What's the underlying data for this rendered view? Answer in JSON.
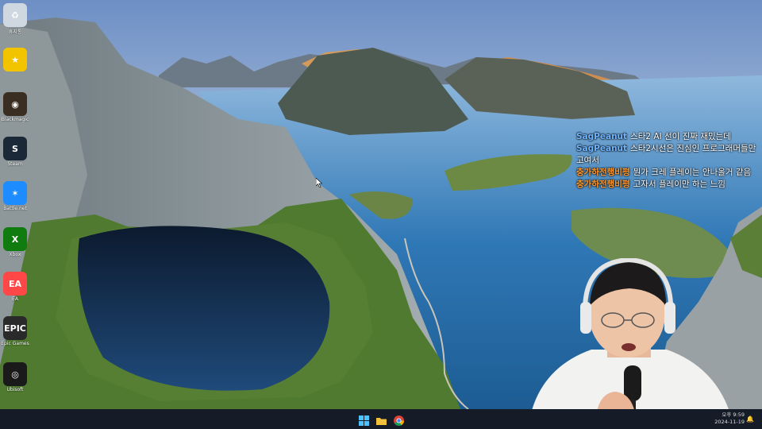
{
  "desktop_icons": [
    {
      "name": "recycle-bin",
      "label": "휴지통",
      "glyph": "♻",
      "color": "#cfd8e0"
    },
    {
      "name": "favorites",
      "label": "",
      "glyph": "★",
      "color": "#f2c400"
    },
    {
      "name": "blackmagic",
      "label": "Blackmagic",
      "glyph": "◉",
      "color": "#3a2e22"
    },
    {
      "name": "steam",
      "label": "Steam",
      "glyph": "S",
      "color": "#1b2838"
    },
    {
      "name": "battle-net",
      "label": "Battle.net",
      "glyph": "✶",
      "color": "#1d8cff"
    },
    {
      "name": "xbox",
      "label": "Xbox",
      "glyph": "X",
      "color": "#107c10"
    },
    {
      "name": "ea",
      "label": "EA",
      "glyph": "EA",
      "color": "#ff4747"
    },
    {
      "name": "epic-games",
      "label": "Epic Games",
      "glyph": "EPIC",
      "color": "#2a2a2a"
    },
    {
      "name": "ubisoft",
      "label": "Ubisoft",
      "glyph": "◎",
      "color": "#1a1a1a"
    }
  ],
  "chat": {
    "messages": [
      {
        "user": "SagPeanut",
        "user_color": "blue",
        "text": "스타2 AI 선이 진짜 재밌는데"
      },
      {
        "user": "SagPeanut",
        "user_color": "blue",
        "text": "스타2시선은 진심인 프로그래머들만 고여서"
      },
      {
        "user": "충가하전행비평",
        "user_color": "orange",
        "text": "뭔가 크레 플레이는 안나올거 같음"
      },
      {
        "user": "충가하전행비평",
        "user_color": "orange",
        "text": "고자서 플레이만 하는 느낌"
      }
    ]
  },
  "taskbar": {
    "time": "오후 9:59",
    "date": "2024-11-19"
  },
  "colors": {
    "taskbar": "#151c28",
    "chat_user_blue": "#6fb4ff",
    "chat_user_orange": "#ff9a2e"
  }
}
